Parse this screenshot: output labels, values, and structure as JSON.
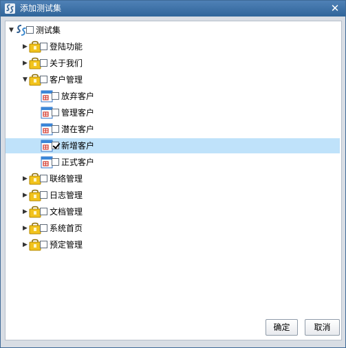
{
  "dialog": {
    "title": "添加测试集",
    "ok_label": "确定",
    "cancel_label": "取消"
  },
  "tree": {
    "root": {
      "label": "测试集",
      "expanded": true,
      "checked": false,
      "icon": "swirl-logo-icon"
    },
    "modules": [
      {
        "label": "登陆功能",
        "expanded": false,
        "checked": false,
        "icon": "folder-lock-icon"
      },
      {
        "label": "关于我们",
        "expanded": false,
        "checked": false,
        "icon": "folder-lock-icon"
      },
      {
        "label": "客户管理",
        "expanded": true,
        "checked": false,
        "icon": "folder-lock-icon",
        "children": [
          {
            "label": "放弃客户",
            "checked": false,
            "selected": false,
            "icon": "page-table-icon"
          },
          {
            "label": "管理客户",
            "checked": false,
            "selected": false,
            "icon": "page-table-icon"
          },
          {
            "label": "潜在客户",
            "checked": false,
            "selected": false,
            "icon": "page-table-icon"
          },
          {
            "label": "新增客户",
            "checked": true,
            "selected": true,
            "icon": "page-table-icon"
          },
          {
            "label": "正式客户",
            "checked": false,
            "selected": false,
            "icon": "page-table-icon"
          }
        ]
      },
      {
        "label": "联络管理",
        "expanded": false,
        "checked": false,
        "icon": "folder-lock-icon"
      },
      {
        "label": "日志管理",
        "expanded": false,
        "checked": false,
        "icon": "folder-lock-icon"
      },
      {
        "label": "文档管理",
        "expanded": false,
        "checked": false,
        "icon": "folder-lock-icon"
      },
      {
        "label": "系统首页",
        "expanded": false,
        "checked": false,
        "icon": "folder-lock-icon"
      },
      {
        "label": "预定管理",
        "expanded": false,
        "checked": false,
        "icon": "folder-lock-icon"
      }
    ]
  },
  "colors": {
    "titlebar": "#3d71a6",
    "selection": "#bfe2fa",
    "folder": "#f2c31c"
  }
}
